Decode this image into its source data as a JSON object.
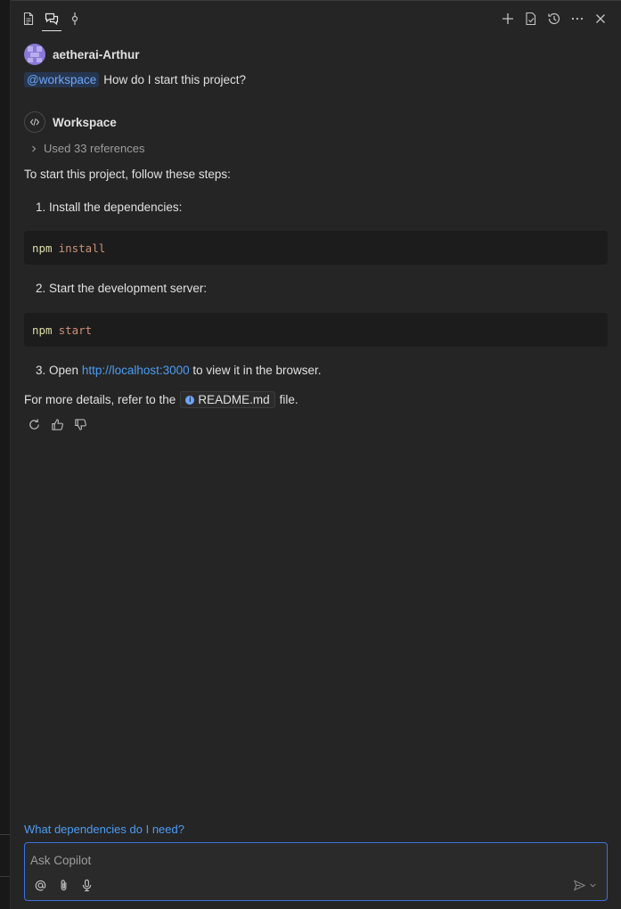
{
  "user": {
    "name": "aetherai-Arthur"
  },
  "user_message": {
    "mention": "@workspace",
    "text": "How do I start this project?"
  },
  "agent": {
    "name": "Workspace"
  },
  "references": {
    "label": "Used 33 references"
  },
  "response": {
    "intro": "To start this project, follow these steps:",
    "steps": [
      {
        "label": "1. Install the dependencies:",
        "code": {
          "cmd": "npm",
          "arg": "install"
        }
      },
      {
        "label": "2. Start the development server:",
        "code": {
          "cmd": "npm",
          "arg": "start"
        }
      },
      {
        "prefix": "3. Open",
        "link": "http://localhost:3000",
        "suffix": "to view it in the browser."
      }
    ],
    "more": {
      "prefix": "For more details, refer to the",
      "file": "README.md",
      "suffix": "file."
    }
  },
  "suggestion": "What dependencies do I need?",
  "input": {
    "placeholder": "Ask Copilot"
  },
  "icons": {
    "tabs": [
      "file-icon",
      "chat-icon",
      "commit-icon"
    ],
    "actions": [
      "plus-icon",
      "open-editor-icon",
      "history-icon",
      "more-icon",
      "close-icon"
    ],
    "feedback": [
      "retry-icon",
      "thumbs-up-icon",
      "thumbs-down-icon"
    ],
    "input": [
      "at-icon",
      "attach-icon",
      "mic-icon",
      "send-icon",
      "chevron-down-icon"
    ]
  },
  "colors": {
    "accent": "#3f72d8",
    "link": "#4c9df3",
    "mention_bg": "#26364f",
    "avatar": "#8a79d6"
  }
}
